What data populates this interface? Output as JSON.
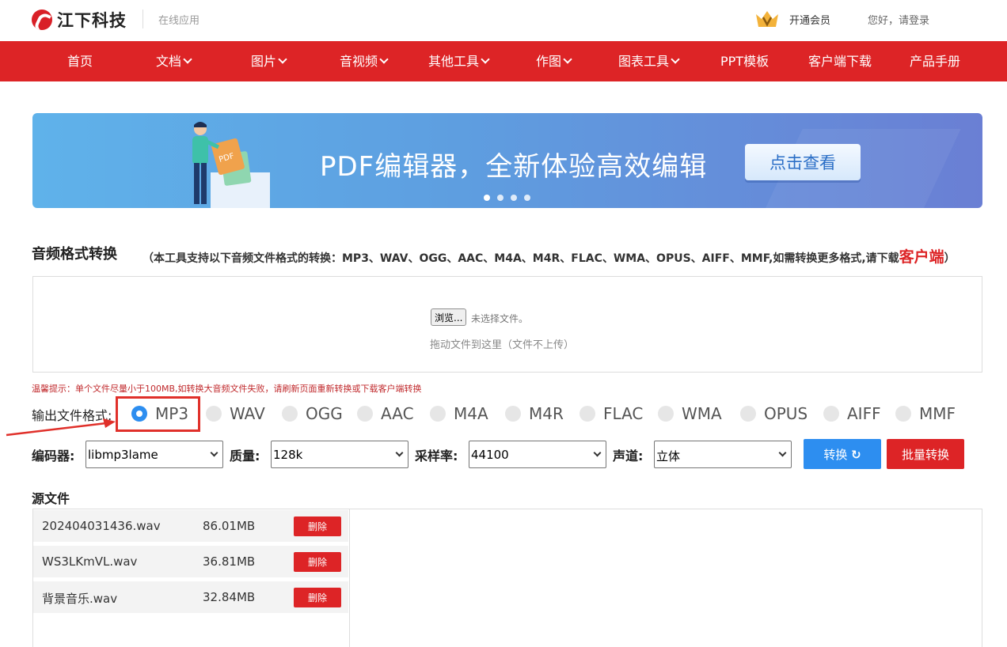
{
  "header": {
    "logo_text": "江下科技",
    "subtitle": "在线应用",
    "vip_label": "开通会员",
    "login_text": "您好，请登录"
  },
  "nav": {
    "items": [
      {
        "label": "首页",
        "dropdown": false
      },
      {
        "label": "文档",
        "dropdown": true
      },
      {
        "label": "图片",
        "dropdown": true
      },
      {
        "label": "音视频",
        "dropdown": true
      },
      {
        "label": "其他工具",
        "dropdown": true
      },
      {
        "label": "作图",
        "dropdown": true
      },
      {
        "label": "图表工具",
        "dropdown": true
      },
      {
        "label": "PPT模板",
        "dropdown": false
      },
      {
        "label": "客户端下载",
        "dropdown": false
      },
      {
        "label": "产品手册",
        "dropdown": false
      }
    ]
  },
  "banner": {
    "badge": "PDF",
    "headline": "PDF编辑器，全新体验高效编辑",
    "button_label": "点击查看",
    "dot_count": 4,
    "active_dot": 0
  },
  "section": {
    "title": "音频格式转换",
    "note_prefix": "（本工具支持以下音频文件格式的转换：MP3、WAV、OGG、AAC、M4A、M4R、FLAC、WMA、OPUS、AIFF、MMF,如需转换更多格式,请下载",
    "note_link": "客户端",
    "note_suffix": "）"
  },
  "upload": {
    "browse_label": "浏览...",
    "no_file_text": "未选择文件。",
    "drop_hint": "拖动文件到这里（文件不上传）"
  },
  "tip": "温馨提示：单个文件尽量小于100MB,如转换大音频文件失败，请刷新页面重新转换或下载客户端转换",
  "format": {
    "label": "输出文件格式:",
    "options": [
      "MP3",
      "WAV",
      "OGG",
      "AAC",
      "M4A",
      "M4R",
      "FLAC",
      "WMA",
      "OPUS",
      "AIFF",
      "MMF"
    ],
    "selected": "MP3"
  },
  "options": {
    "encoder_label": "编码器:",
    "encoder_value": "libmp3lame",
    "quality_label": "质量:",
    "quality_value": "128k",
    "samplerate_label": "采样率:",
    "samplerate_value": "44100",
    "channel_label": "声道:",
    "channel_value": "立体",
    "convert_label": "转换",
    "batch_label": "批量转换"
  },
  "source": {
    "title": "源文件",
    "delete_label": "删除",
    "files": [
      {
        "name": "202404031436.wav",
        "size": "86.01MB"
      },
      {
        "name": "WS3LKmVL.wav",
        "size": "36.81MB"
      },
      {
        "name": "背景音乐.wav",
        "size": "32.84MB"
      }
    ]
  },
  "colors": {
    "brand_red": "#dd2426",
    "accent_blue": "#2d8ef0",
    "highlight_red": "#e0302a"
  }
}
